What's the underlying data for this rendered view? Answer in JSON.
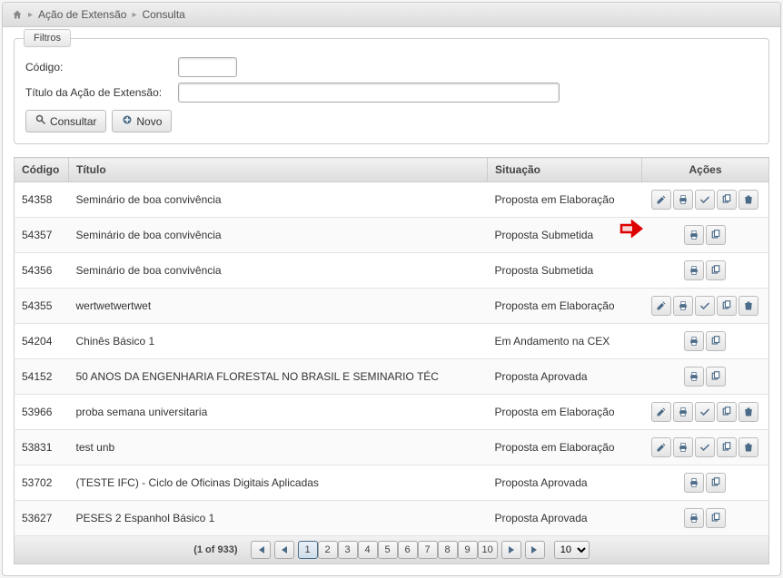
{
  "breadcrumb": {
    "item1": "Ação de Extensão",
    "item2": "Consulta"
  },
  "filters": {
    "legend": "Filtros",
    "codigo_label": "Código:",
    "codigo_value": "",
    "titulo_label": "Título da Ação de Extensão:",
    "titulo_value": "",
    "consultar_label": "Consultar",
    "novo_label": "Novo"
  },
  "table": {
    "headers": {
      "codigo": "Código",
      "titulo": "Título",
      "situacao": "Situação",
      "acoes": "Ações"
    },
    "rows": [
      {
        "codigo": "54358",
        "titulo": "Seminário de boa convivência",
        "situacao": "Proposta em Elaboração",
        "actions": "full"
      },
      {
        "codigo": "54357",
        "titulo": "Seminário de boa convivência",
        "situacao": "Proposta Submetida",
        "actions": "print_copy",
        "highlight": true
      },
      {
        "codigo": "54356",
        "titulo": "Seminário de boa convivência",
        "situacao": "Proposta Submetida",
        "actions": "print_copy"
      },
      {
        "codigo": "54355",
        "titulo": "wertwetwertwet",
        "situacao": "Proposta em Elaboração",
        "actions": "full"
      },
      {
        "codigo": "54204",
        "titulo": "Chinês Básico 1",
        "situacao": "Em Andamento na CEX",
        "actions": "print_copy"
      },
      {
        "codigo": "54152",
        "titulo": "50 ANOS DA ENGENHARIA FLORESTAL NO BRASIL E SEMINARIO TÉC",
        "situacao": "Proposta Aprovada",
        "actions": "print_copy"
      },
      {
        "codigo": "53966",
        "titulo": "proba semana universitaria",
        "situacao": "Proposta em Elaboração",
        "actions": "full"
      },
      {
        "codigo": "53831",
        "titulo": "test unb",
        "situacao": "Proposta em Elaboração",
        "actions": "full"
      },
      {
        "codigo": "53702",
        "titulo": "(TESTE IFC) - Ciclo de Oficinas Digitais Aplicadas",
        "situacao": "Proposta Aprovada",
        "actions": "print_copy"
      },
      {
        "codigo": "53627",
        "titulo": "PESES 2 Espanhol Básico 1",
        "situacao": "Proposta Aprovada",
        "actions": "print_copy"
      }
    ]
  },
  "paginator": {
    "info": "(1 of 933)",
    "pages": [
      "1",
      "2",
      "3",
      "4",
      "5",
      "6",
      "7",
      "8",
      "9",
      "10"
    ],
    "active_page": "1",
    "page_size": "10"
  }
}
